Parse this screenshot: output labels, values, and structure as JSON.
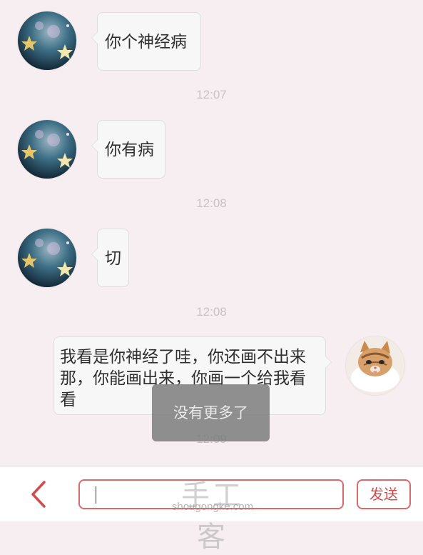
{
  "messages": [
    {
      "side": "left",
      "text": "你个神经病"
    },
    {
      "side": "left",
      "text": "你有病"
    },
    {
      "side": "left",
      "text": "切"
    },
    {
      "side": "right",
      "text": "我看是你神经了哇，你还画不出来那，你能画出来，你画一个给我看看"
    }
  ],
  "timestamps": [
    "12:07",
    "12:08",
    "12:08",
    "12:09"
  ],
  "toast": "没有更多了",
  "input": {
    "value": "",
    "placeholder": ""
  },
  "send_label": "发送",
  "watermark": {
    "title": "手工客",
    "url": "shougongke.com"
  },
  "icons": {
    "back": "chevron-left-icon",
    "contact_avatar": "starry-night-avatar",
    "self_avatar": "kitten-avatar"
  },
  "colors": {
    "background": "#f6eef0",
    "accent": "#d76b6b",
    "bubble": "#f7f7f7",
    "timestamp": "#c9c1c3"
  }
}
